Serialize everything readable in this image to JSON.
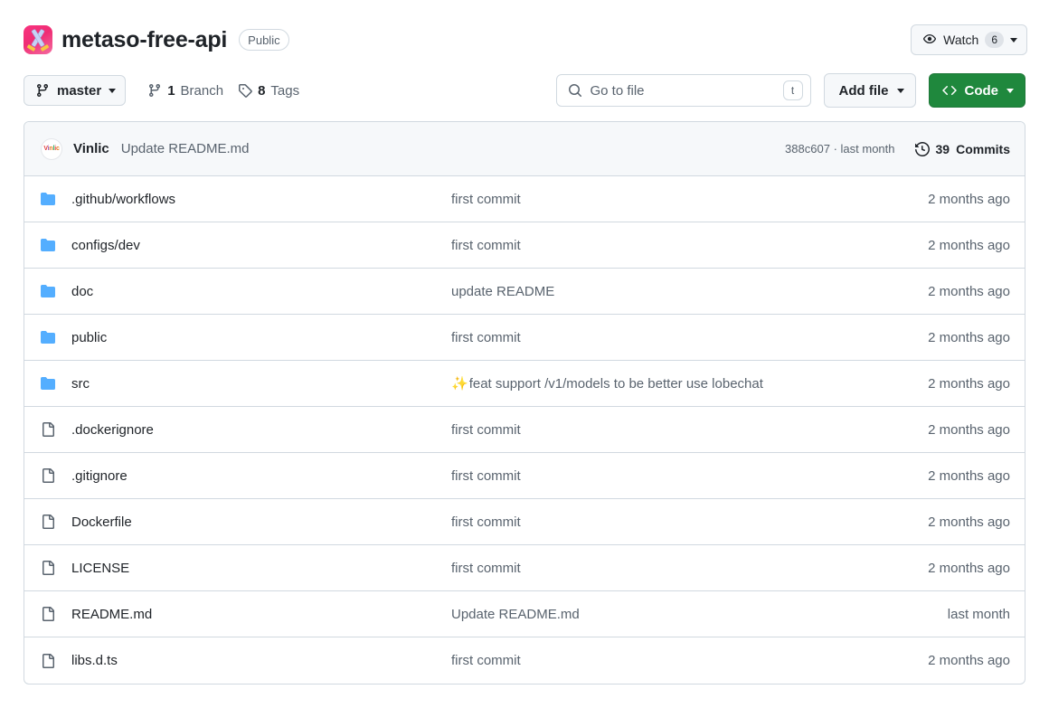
{
  "header": {
    "repo_name": "metaso-free-api",
    "visibility": "Public",
    "repo_icon": "crossed-swords-app-icon",
    "watch": {
      "label": "Watch",
      "count": "6",
      "icon": "eye-icon"
    }
  },
  "toolbar": {
    "branch": {
      "name": "master",
      "icon": "git-branch-icon"
    },
    "branch_count": {
      "num": "1",
      "label": "Branch",
      "icon": "git-branch-icon"
    },
    "tag_count": {
      "num": "8",
      "label": "Tags",
      "icon": "tag-icon"
    },
    "search": {
      "placeholder": "Go to file",
      "icon": "search-icon",
      "shortcut": "t"
    },
    "add_file": "Add file",
    "code": "Code",
    "code_icon": "angle-brackets-icon",
    "code_color": "#1f883d"
  },
  "commit_bar": {
    "author": "Vinlic",
    "avatar_text": "Vinlic",
    "message": "Update README.md",
    "hash": "388c607",
    "separator": "·",
    "time": "last month",
    "commits_count": "39",
    "commits_label": "Commits",
    "history_icon": "history-clock-icon"
  },
  "files": [
    {
      "type": "folder",
      "icon": "folder-icon",
      "name": ".github/workflows",
      "message": "first commit",
      "emoji": "",
      "time": "2 months ago"
    },
    {
      "type": "folder",
      "icon": "folder-icon",
      "name": "configs/dev",
      "message": "first commit",
      "emoji": "",
      "time": "2 months ago"
    },
    {
      "type": "folder",
      "icon": "folder-icon",
      "name": "doc",
      "message": "update README",
      "emoji": "",
      "time": "2 months ago"
    },
    {
      "type": "folder",
      "icon": "folder-icon",
      "name": "public",
      "message": "first commit",
      "emoji": "",
      "time": "2 months ago"
    },
    {
      "type": "folder",
      "icon": "folder-icon",
      "name": "src",
      "message": "feat support /v1/models to be better use lobechat",
      "emoji": "✨",
      "time": "2 months ago"
    },
    {
      "type": "file",
      "icon": "file-icon",
      "name": ".dockerignore",
      "message": "first commit",
      "emoji": "",
      "time": "2 months ago"
    },
    {
      "type": "file",
      "icon": "file-icon",
      "name": ".gitignore",
      "message": "first commit",
      "emoji": "",
      "time": "2 months ago"
    },
    {
      "type": "file",
      "icon": "file-icon",
      "name": "Dockerfile",
      "message": "first commit",
      "emoji": "",
      "time": "2 months ago"
    },
    {
      "type": "file",
      "icon": "file-icon",
      "name": "LICENSE",
      "message": "first commit",
      "emoji": "",
      "time": "2 months ago"
    },
    {
      "type": "file",
      "icon": "file-icon",
      "name": "README.md",
      "message": "Update README.md",
      "emoji": "",
      "time": "last month"
    },
    {
      "type": "file",
      "icon": "file-icon",
      "name": "libs.d.ts",
      "message": "first commit",
      "emoji": "",
      "time": "2 months ago"
    }
  ],
  "colors": {
    "folder": "#54aeff",
    "file": "#59636e",
    "border": "#d1d9e0",
    "subtle_bg": "#f6f8fa"
  }
}
